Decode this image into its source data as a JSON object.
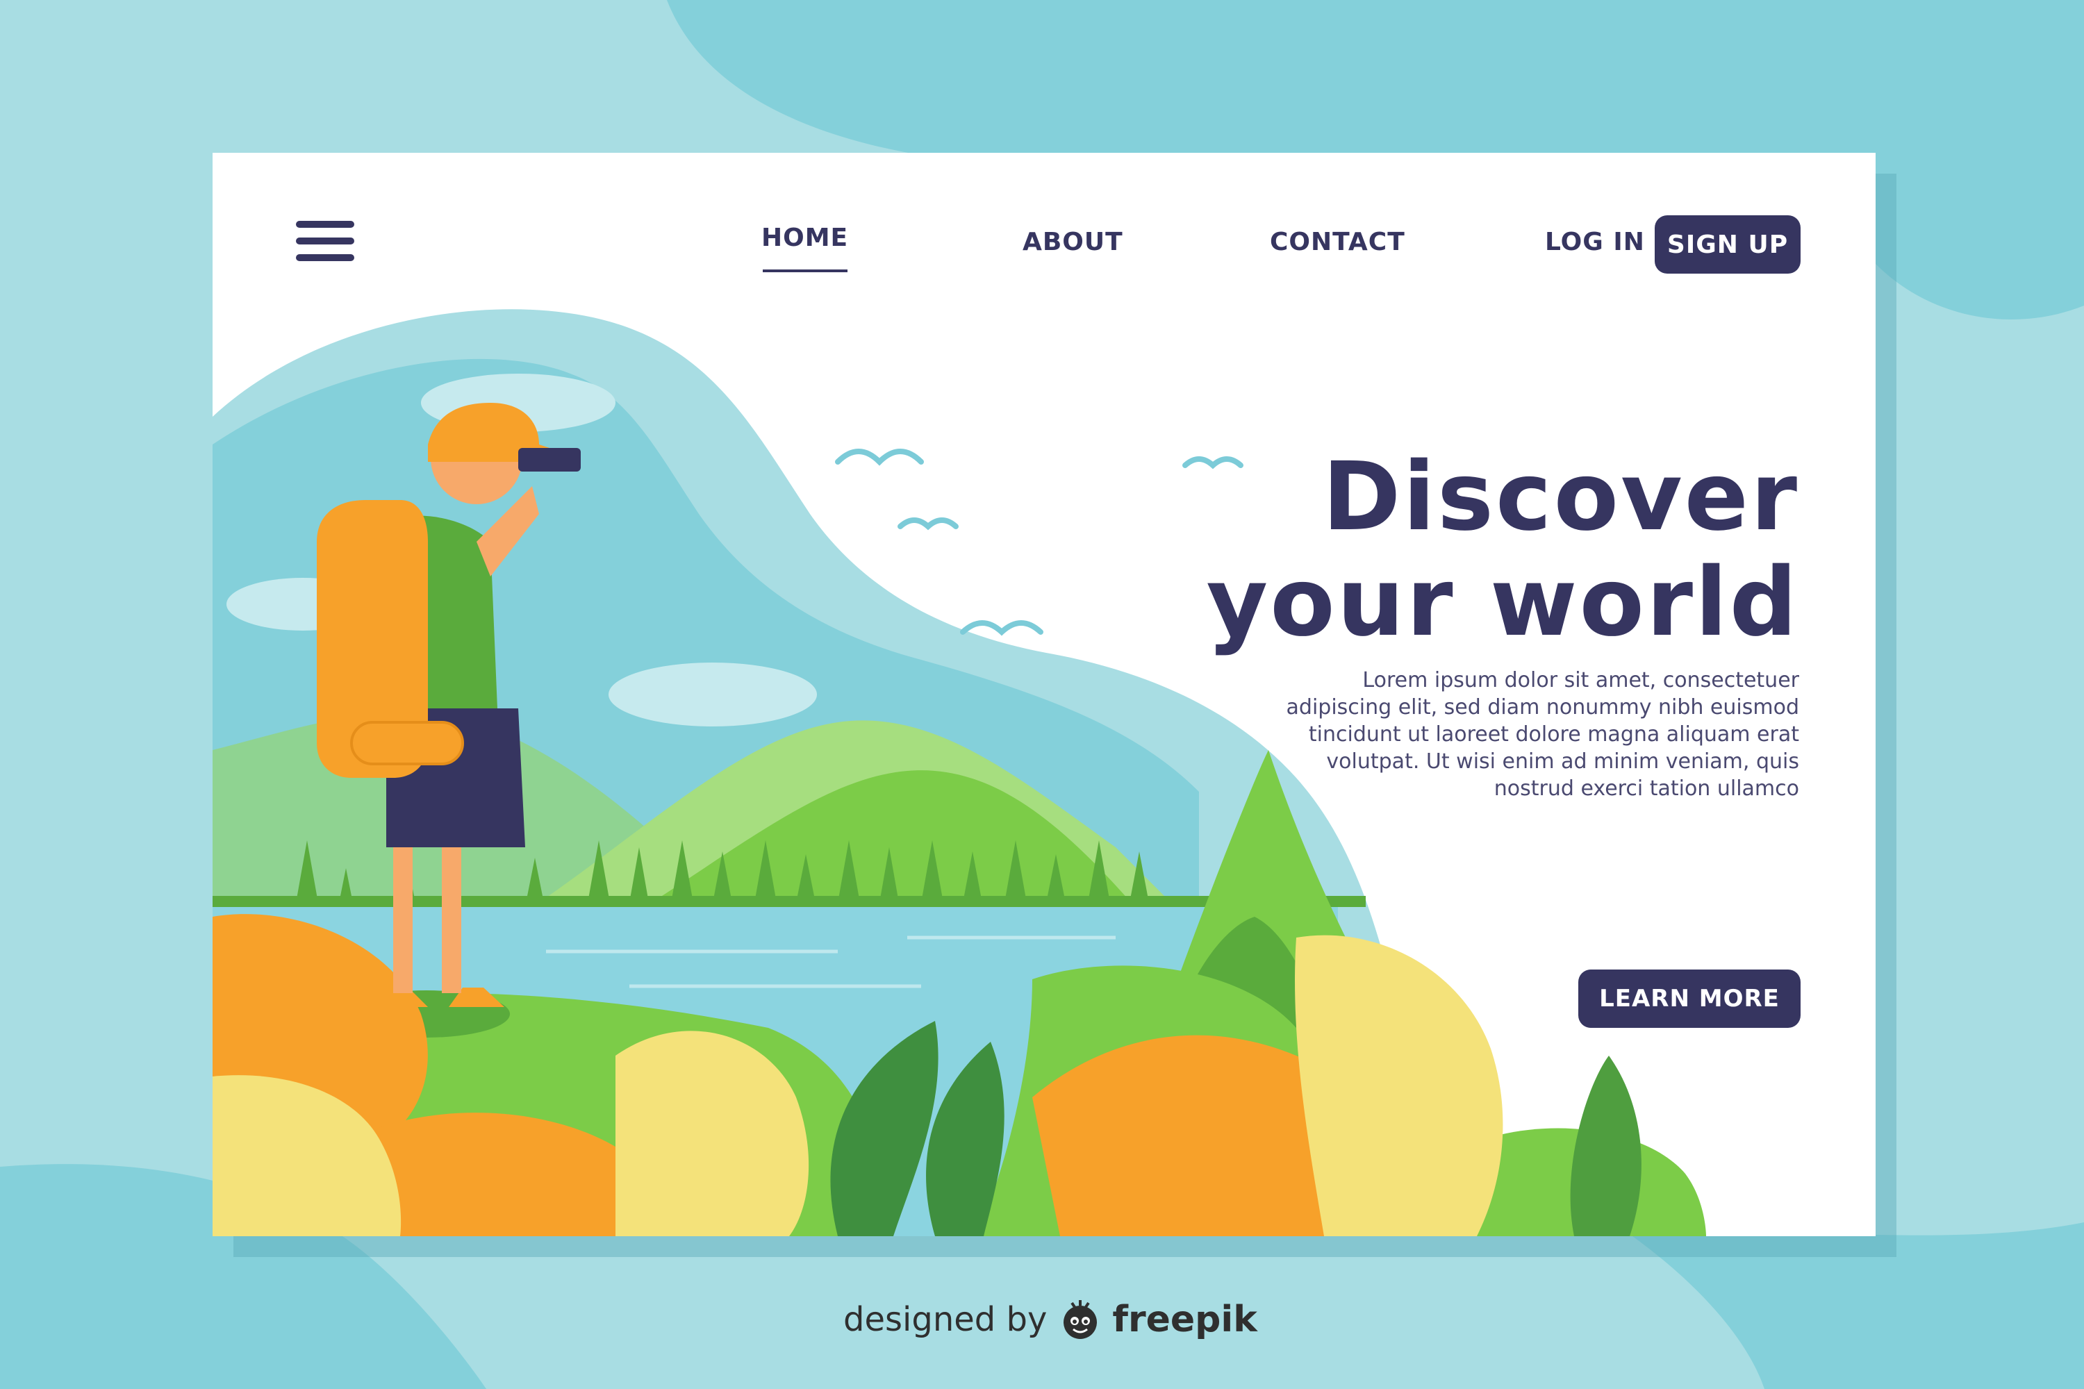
{
  "nav": {
    "home": "HOME",
    "about": "ABOUT",
    "contact": "CONTACT",
    "login": "LOG IN",
    "signup": "SIGN UP"
  },
  "hero": {
    "title_line1": "Discover",
    "title_line2": "your world",
    "body_lines": [
      "Lorem ipsum dolor sit amet, consectetuer",
      "adipiscing elit, sed diam nonummy nibh euismod",
      "tincidunt ut laoreet dolore magna aliquam erat",
      "volutpat. Ut wisi enim ad minim veniam, quis",
      "nostrud exerci tation ullamco"
    ],
    "cta": "LEARN MORE"
  },
  "credit": {
    "prefix": "designed by",
    "brand": "freepik"
  },
  "colors": {
    "navy": "#363560",
    "sky": "#a8dde3",
    "grass": "#7ccc48",
    "orange": "#f7a12a",
    "yellow": "#f4e27a"
  },
  "icons": {
    "menu": "hamburger-menu-icon",
    "logo": "freepik-logo-icon"
  }
}
